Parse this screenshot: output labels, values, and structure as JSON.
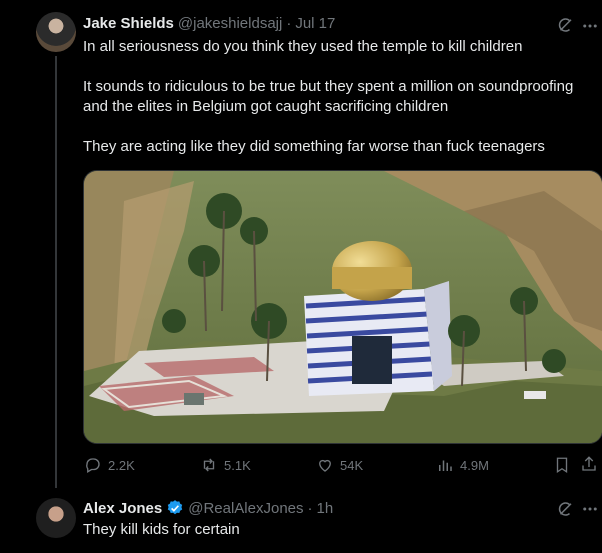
{
  "tweet1": {
    "author_name": "Jake Shields",
    "handle": "@jakeshieldsajj",
    "separator": "·",
    "date": "Jul 17",
    "text": "In all seriousness do you think they used the temple to kill children\n\nIt sounds to ridiculous to be true but they spent a million on soundproofing and the elites in Belgium got caught sacrificing children\n\nThey are acting like they did something far worse than fuck teenagers",
    "actions": {
      "replies": "2.2K",
      "reposts": "5.1K",
      "likes": "54K",
      "views": "4.9M"
    }
  },
  "tweet2": {
    "author_name": "Alex Jones",
    "handle": "@RealAlexJones",
    "separator": "·",
    "time": "1h",
    "text": "They kill kids for certain"
  },
  "colors": {
    "background": "#000000",
    "text": "#e7e9ea",
    "muted": "#71767b",
    "verified": "#1d9bf0",
    "border": "#2f3336"
  },
  "icons": {
    "more": "more-icon",
    "grok": "grok-icon",
    "reply": "reply-icon",
    "repost": "repost-icon",
    "like": "like-icon",
    "views": "views-icon",
    "bookmark": "bookmark-icon",
    "share": "share-icon",
    "verified": "verified-badge-icon"
  }
}
